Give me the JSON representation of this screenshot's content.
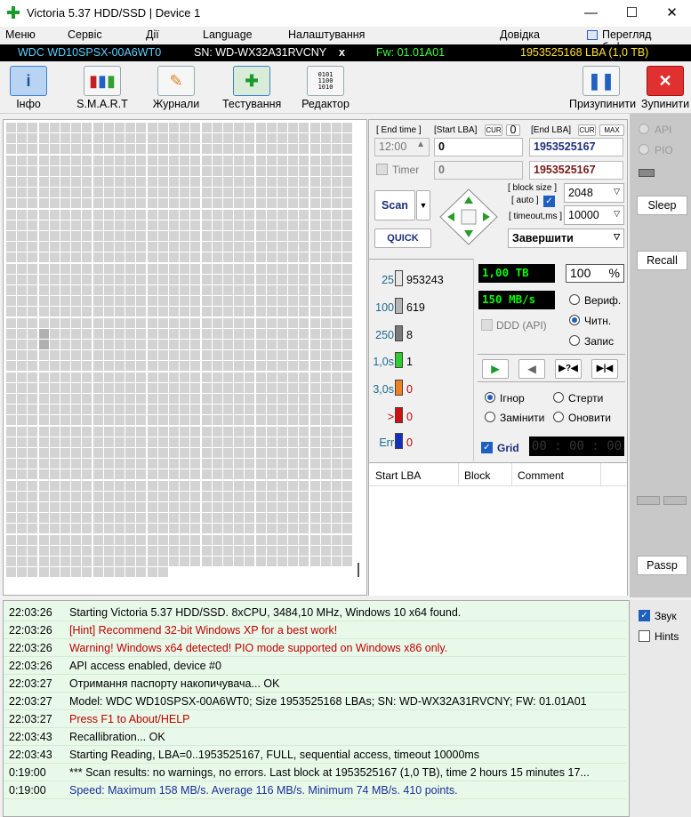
{
  "window": {
    "title": "Victoria 5.37 HDD/SSD | Device 1",
    "minimize": "—",
    "maximize": "☐",
    "close": "✕"
  },
  "menu": [
    "Меню",
    "Сервіс",
    "Дії",
    "Language",
    "Налаштування",
    "Довідка",
    "Перегляд буфера"
  ],
  "drive": {
    "model": "WDC WD10SPSX-00A6WT0",
    "serial": "SN: WD-WX32A31RVCNY",
    "x": "x",
    "fw": "Fw: 01.01A01",
    "lba": "1953525168 LBA (1,0 TB)"
  },
  "toolbar": {
    "info": "Інфо",
    "smart": "S.M.A.R.T",
    "logs": "Журнали",
    "test": "Тестування",
    "editor": "Редактор",
    "pause": "Призупинити",
    "stop": "Зупинити"
  },
  "test": {
    "end_time_label": "[ End time ]",
    "end_time_value": "12:00",
    "timer_label": "Timer",
    "start_lba_label": "[Start LBA]",
    "cur_label": "CUR",
    "cur_value": "0",
    "start_lba_value": "0",
    "timer_value": "0",
    "end_lba_label": "[End LBA]",
    "cur2": "CUR",
    "max": "MAX",
    "end_lba_value": "1953525167",
    "end_lba_value2": "1953525167",
    "scan_label": "Scan",
    "quick_label": "QUICK",
    "block_size_label": "[ block size ]",
    "auto_label": "[ auto ]",
    "timeout_label": "[ timeout,ms ]",
    "block_size_value": "2048",
    "timeout_value": "10000",
    "action_value": "Завершити"
  },
  "legend": [
    {
      "label": "25",
      "count": "953243",
      "color": "#e6e6e6",
      "label_color": "#1a6b8f"
    },
    {
      "label": "100",
      "count": "619",
      "color": "#b5b5b5",
      "label_color": "#1a6b8f"
    },
    {
      "label": "250",
      "count": "8",
      "color": "#7a7a7a",
      "label_color": "#1a6b8f"
    },
    {
      "label": "1,0s",
      "count": "1",
      "color": "#2ecc2e",
      "label_color": "#1a6b8f"
    },
    {
      "label": "3,0s",
      "count": "0",
      "color": "#f08020",
      "label_color": "#1a6b8f"
    },
    {
      "label": ">",
      "count": "0",
      "color": "#d01010",
      "label_color": "#c00000"
    },
    {
      "label": "Err",
      "count": "0",
      "color": "#1030c0",
      "label_color": "#1a6b8f"
    }
  ],
  "stats": {
    "capacity": "1,00 TB",
    "percent": "100",
    "percent_sign": "%",
    "speed": "150 MB/s",
    "ddd": "DDD (API)",
    "verify": "Вериф.",
    "read": "Читн.",
    "write": "Запис",
    "ignore": "Ігнор",
    "erase": "Стерти",
    "replace": "Замінити",
    "refresh": "Оновити",
    "grid": "Grid",
    "timer": "00 : 00 : 00"
  },
  "table": {
    "columns": [
      "Start LBA",
      "Block",
      "Comment"
    ]
  },
  "side": {
    "api": "API",
    "pio": "PIO",
    "sleep": "Sleep",
    "recall": "Recall",
    "passp": "Passp",
    "sound": "Звук",
    "hints": "Hints"
  },
  "log": [
    {
      "time": "22:03:26",
      "msg": "Starting Victoria 5.37 HDD/SSD. 8xCPU, 3484,10 MHz, Windows 10 x64 found.",
      "color": "#000000"
    },
    {
      "time": "22:03:26",
      "msg": "[Hint] Recommend 32-bit Windows XP for a best work!",
      "color": "#c00000"
    },
    {
      "time": "22:03:26",
      "msg": "Warning! Windows x64 detected! PIO mode supported on Windows x86 only.",
      "color": "#c00000"
    },
    {
      "time": "22:03:26",
      "msg": "API access enabled, device #0",
      "color": "#000000"
    },
    {
      "time": "22:03:27",
      "msg": "Отримання паспорту накопичувача... OK",
      "color": "#000000"
    },
    {
      "time": "22:03:27",
      "msg": "Model: WDC WD10SPSX-00A6WT0; Size 1953525168 LBAs; SN: WD-WX32A31RVCNY; FW: 01.01A01",
      "color": "#000000"
    },
    {
      "time": "22:03:27",
      "msg": "Press F1 to About/HELP",
      "color": "#c00000"
    },
    {
      "time": "22:03:43",
      "msg": "Recallibration... OK",
      "color": "#000000"
    },
    {
      "time": "22:03:43",
      "msg": "Starting Reading, LBA=0..1953525167, FULL, sequential access, timeout 10000ms",
      "color": "#000000"
    },
    {
      "time": "0:19:00",
      "msg": "*** Scan results: no warnings, no errors. Last block at 1953525167 (1,0 TB), time 2 hours 15 minutes 17...",
      "color": "#000000"
    },
    {
      "time": "0:19:00",
      "msg": "Speed: Maximum 158 MB/s. Average 116 MB/s. Minimum 74 MB/s. 410 points.",
      "color": "#1a2f9a"
    }
  ]
}
